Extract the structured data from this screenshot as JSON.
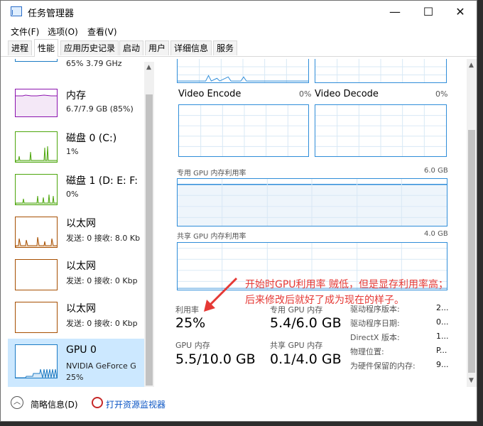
{
  "window": {
    "title": "任务管理器"
  },
  "controls": {
    "minimize": "—",
    "maximize": "☐",
    "close": "✕"
  },
  "menu": [
    "文件(F)",
    "选项(O)",
    "查看(V)"
  ],
  "tabs": [
    "进程",
    "性能",
    "应用历史记录",
    "启动",
    "用户",
    "详细信息",
    "服务"
  ],
  "active_tab": "性能",
  "sidebar": {
    "cpu_partial": "65% 3.79 GHz",
    "items": [
      {
        "title": "内存",
        "sub": "6.7/7.9 GB (85%)",
        "sub2": ""
      },
      {
        "title": "磁盘 0 (C:)",
        "sub": "1%",
        "sub2": ""
      },
      {
        "title": "磁盘 1 (D: E: F:",
        "sub": "0%",
        "sub2": ""
      },
      {
        "title": "以太网",
        "sub": "发送: 0  接收: 8.0 Kb",
        "sub2": ""
      },
      {
        "title": "以太网",
        "sub": "发送: 0  接收: 0 Kbp",
        "sub2": ""
      },
      {
        "title": "以太网",
        "sub": "发送: 0  接收: 0 Kbp",
        "sub2": ""
      },
      {
        "title": "GPU 0",
        "sub": "NVIDIA GeForce G",
        "sub2": "25%"
      }
    ]
  },
  "engines": {
    "video_encode": {
      "label": "Video Encode",
      "pct": "0%"
    },
    "video_decode": {
      "label": "Video Decode",
      "pct": "0%"
    }
  },
  "dedicated_memory": {
    "label": "专用 GPU 内存利用率",
    "max": "6.0 GB"
  },
  "shared_memory": {
    "label": "共享 GPU 内存利用率",
    "max": "4.0 GB"
  },
  "stats": {
    "utilization": {
      "label": "利用率",
      "value": "25%"
    },
    "dedicated": {
      "label": "专用 GPU 内存",
      "value": "5.4/6.0 GB"
    },
    "gpu_memory": {
      "label": "GPU 内存",
      "value": "5.5/10.0 GB"
    },
    "shared": {
      "label": "共享 GPU 内存",
      "value": "0.1/4.0 GB"
    }
  },
  "details": [
    {
      "label": "驱动程序版本:",
      "value": "2..."
    },
    {
      "label": "驱动程序日期:",
      "value": "0..."
    },
    {
      "label": "DirectX 版本:",
      "value": "1..."
    },
    {
      "label": "物理位置:",
      "value": "P..."
    },
    {
      "label": "为硬件保留的内存:",
      "value": "9..."
    }
  ],
  "footer": {
    "brief": "简略信息(D)",
    "monitor": "打开资源监视器"
  },
  "annotation": {
    "line1": "开始时GPU利用率 贼低，但是显存利用率高；",
    "line2": "后来修改后就好了成为现在的样子。"
  },
  "colors": {
    "memory": "#8b12ae",
    "disk": "#4da60c",
    "ethernet": "#a74f01",
    "gpu": "#1c7bc4",
    "annotation": "#e53935"
  }
}
